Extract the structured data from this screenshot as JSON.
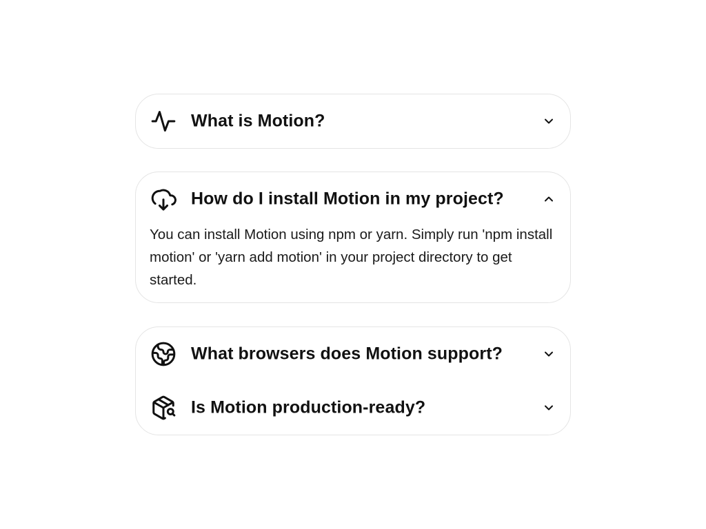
{
  "faq": {
    "items": [
      {
        "question": "What is Motion?",
        "icon": "activity-icon",
        "expanded": false
      },
      {
        "question": "How do I install Motion in my project?",
        "icon": "cloud-download-icon",
        "expanded": true,
        "answer": "You can install Motion using npm or yarn. Simply run 'npm install motion' or 'yarn add motion' in your project directory to get started."
      },
      {
        "question": "What browsers does Motion support?",
        "icon": "globe-icon",
        "expanded": false
      },
      {
        "question": "Is Motion production-ready?",
        "icon": "package-search-icon",
        "expanded": false
      }
    ]
  },
  "colors": {
    "text": "#111111",
    "border": "#e4e4e4",
    "background": "#ffffff"
  }
}
